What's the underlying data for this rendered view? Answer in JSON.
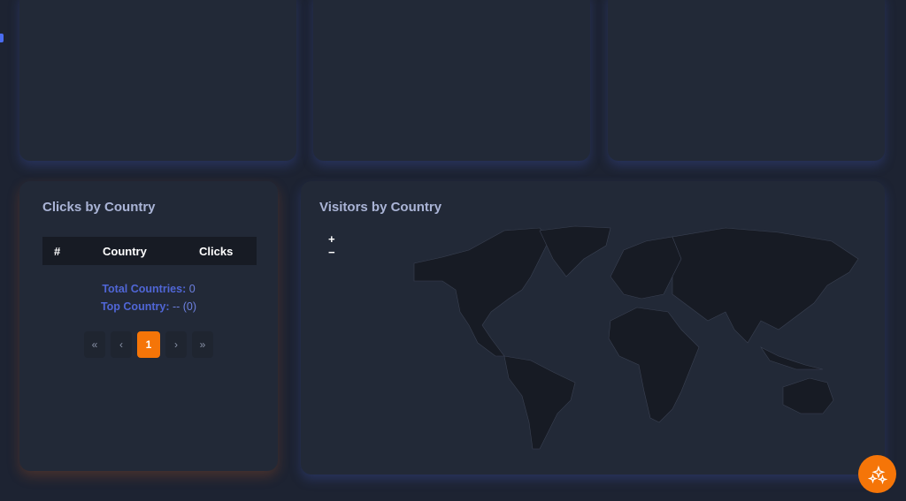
{
  "clicks_card": {
    "title": "Clicks by Country",
    "columns": [
      "#",
      "Country",
      "Clicks"
    ],
    "total_label": "Total Countries:",
    "total_value": "0",
    "top_label": "Top Country:",
    "top_value": "-- (0)",
    "pagination": {
      "first": "«",
      "prev": "‹",
      "current": "1",
      "next": "›",
      "last": "»"
    }
  },
  "visitors_card": {
    "title": "Visitors by Country",
    "zoom_in": "+",
    "zoom_out": "−"
  },
  "colors": {
    "accent": "#f57508",
    "label_blue": "#5066d6",
    "card_bg": "#222937"
  }
}
